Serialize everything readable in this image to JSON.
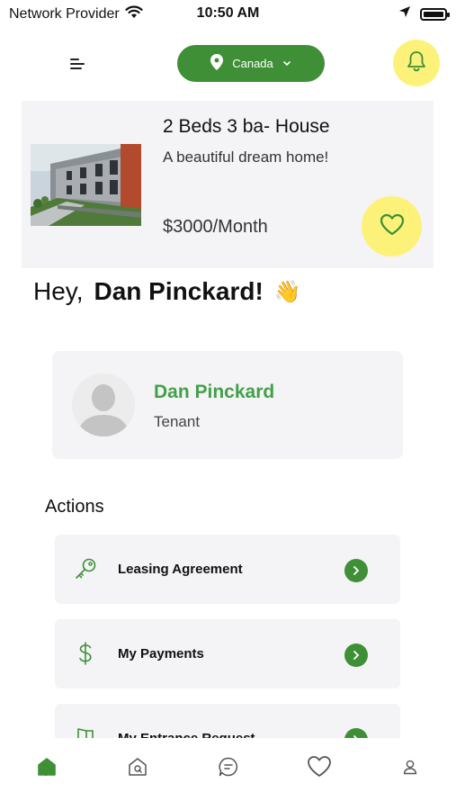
{
  "status_bar": {
    "carrier": "Network Provider",
    "time": "10:50 AM"
  },
  "header": {
    "location": "Canada"
  },
  "property": {
    "title": "2 Beds 3 ba- House",
    "description": "A beautiful dream home!",
    "price": "$3000/Month"
  },
  "greeting": {
    "hey": "Hey,",
    "name": "Dan Pinckard!",
    "emoji": "👋"
  },
  "profile": {
    "name": "Dan Pinckard",
    "role": "Tenant"
  },
  "actions": {
    "title": "Actions",
    "items": [
      {
        "label": "Leasing Agreement",
        "icon": "key-icon"
      },
      {
        "label": "My Payments",
        "icon": "dollar-icon"
      },
      {
        "label": "My Entrance Request",
        "icon": "door-icon"
      }
    ]
  },
  "tabbar": {
    "items": [
      "home-icon",
      "property-icon",
      "chat-icon",
      "heart-icon",
      "profile-icon"
    ],
    "active": "home-icon"
  },
  "colors": {
    "brand_green": "#3f8f37",
    "accent_yellow": "#fdf279",
    "name_green": "#43a047",
    "card_bg": "#f4f4f6"
  }
}
